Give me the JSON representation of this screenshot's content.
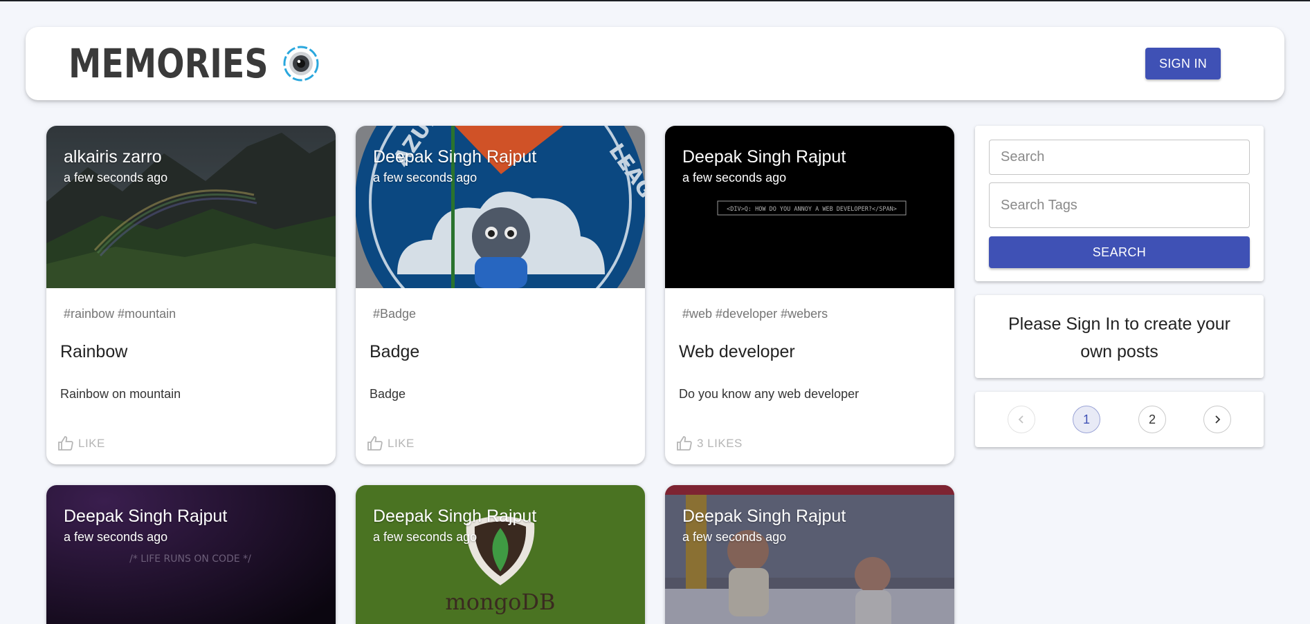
{
  "header": {
    "brand": "MEMORIES",
    "sign_in_label": "SIGN IN"
  },
  "posts": [
    {
      "author": "alkairis zarro",
      "time": "a few seconds ago",
      "tags": "#rainbow #mountain",
      "title": "Rainbow",
      "message": "Rainbow on mountain",
      "like_label": "LIKE"
    },
    {
      "author": "Deepak Singh Rajput",
      "time": "a few seconds ago",
      "tags": "#Badge",
      "title": "Badge",
      "message": "Badge",
      "like_label": "LIKE",
      "image_text": {
        "banner": "AZURE",
        "banner2": "LEAGUE"
      }
    },
    {
      "author": "Deepak Singh Rajput",
      "time": "a few seconds ago",
      "tags": "#web #developer #webers",
      "title": "Web developer",
      "message": "Do you know any web developer",
      "like_label": "3 LIKES",
      "image_text": {
        "caption": "<DIV>Q: HOW DO YOU ANNOY A WEB DEVELOPER?</SPAN>"
      }
    },
    {
      "author": "Deepak Singh Rajput",
      "time": "a few seconds ago",
      "image_text": {
        "caption": "/* LIFE RUNS ON CODE */"
      }
    },
    {
      "author": "Deepak Singh Rajput",
      "time": "a few seconds ago",
      "image_text": {
        "caption": "mongoDB"
      }
    },
    {
      "author": "Deepak Singh Rajput",
      "time": "a few seconds ago"
    }
  ],
  "sidebar": {
    "search_placeholder": "Search",
    "search_tags_placeholder": "Search Tags",
    "search_button": "SEARCH",
    "sign_in_note": "Please Sign In to create your own posts",
    "pagination": {
      "pages": [
        "1",
        "2"
      ],
      "current": "1"
    }
  },
  "colors": {
    "primary": "#3f51b5",
    "background": "#f4f6fb"
  }
}
